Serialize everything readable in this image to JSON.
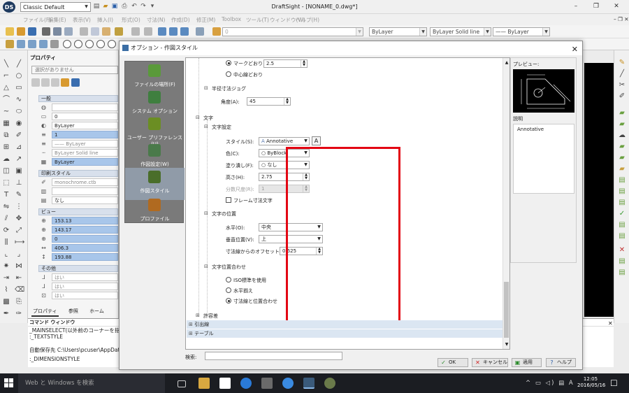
{
  "app": {
    "workspace": "Classic Default",
    "title": "DraftSight - [NONAME_0.dwg*]",
    "menus": [
      "ファイル(F)",
      "編集(E)",
      "表示(V)",
      "挿入(I)",
      "形式(O)",
      "寸法(N)",
      "作成(D)",
      "修正(M)",
      "Toolbox",
      "ツール(T)",
      "ウィンドウ(W)",
      "ヘルプ(H)"
    ]
  },
  "toolbar": {
    "layer_combo": "0",
    "color_combo": "ByLayer",
    "linestyle_combo": "ByLayer    Solid line",
    "lineweight_combo": "—— ByLayer"
  },
  "properties": {
    "title": "プロパティ",
    "selection": "選択がありません",
    "sections": {
      "general": "一般",
      "print_style": "印刷スタイル",
      "view": "ビュー",
      "other": "その他"
    },
    "general_rows": [
      "",
      "0",
      "ByLayer",
      "1",
      "—— ByLayer",
      "ByLayer    Solid line",
      "ByLayer"
    ],
    "print_rows": [
      "monochrome.ctb",
      "",
      "なし"
    ],
    "view_rows": [
      "153.13",
      "143.17",
      "0",
      "406.3",
      "193.88"
    ],
    "other_rows": [
      "はい",
      "はい",
      "はい"
    ],
    "tabs": [
      "プロパティ",
      "参照",
      "ホーム"
    ]
  },
  "command_window": {
    "title": "コマンド ウィンドウ",
    "lines": [
      "_MAINSELECT(以外前のコーナーを指定):",
      ":_TEXTSTYLE",
      "自動保存先 C:\\Users\\pcuser\\AppData",
      ":_DIMENSIONSTYLE"
    ]
  },
  "dialog": {
    "title": "オプション - 作図スタイル",
    "nav": [
      {
        "label": "ファイルの場所(F)",
        "icon": "folder-icon",
        "color": "#5a9a3a"
      },
      {
        "label": "システム オプション",
        "icon": "system-options-icon",
        "color": "#3f7f3f"
      },
      {
        "label": "ユーザー プリファレンス(U)",
        "icon": "user-preferences-icon",
        "color": "#6b8e23"
      },
      {
        "label": "作図設定(W)",
        "icon": "drawing-settings-icon",
        "color": "#4a7a4a"
      },
      {
        "label": "作図スタイル",
        "icon": "drafting-styles-icon",
        "color": "#4a6e2a"
      },
      {
        "label": "プロファイル",
        "icon": "profile-icon",
        "color": "#b06a20"
      }
    ],
    "tree": {
      "marker_radio": "マークどおり",
      "marker_value": "2.5",
      "center_line": "中心線どおり",
      "radius_jog": "半径寸法ジョグ",
      "angle_label": "角度(A):",
      "angle_value": "45",
      "text": "文字",
      "text_settings": "文字設定",
      "style_label": "スタイル(S):",
      "style_value": "Annotative",
      "color_label": "色(C):",
      "color_value": "ByBlock",
      "fill_label": "塗り潰し(F):",
      "fill_value": "なし",
      "height_label": "高さ(H):",
      "height_value": "2.75",
      "fraction_label": "分数尺度(R):",
      "fraction_value": "1",
      "frame_label": "フレーム寸法文字",
      "text_position": "文字の位置",
      "horizontal_label": "水平(O):",
      "horizontal_value": "中央",
      "vertical_label": "垂直位置(V):",
      "vertical_value": "上",
      "offset_label": "寸法線からのオフセット(D):",
      "offset_value": "0.625",
      "text_alignment": "文字位置合わせ",
      "iso_label": "ISO標準を使用",
      "horiz_label": "水平揃え",
      "align_label": "寸法線と位置合わせ",
      "tolerance": "許容差",
      "leader": "引出線",
      "table": "テーブル"
    },
    "search_label": "検索:",
    "preview_label": "プレビュー:",
    "description_label": "説明",
    "description_value": "Annotative",
    "buttons": {
      "ok": "OK",
      "cancel": "キャンセル",
      "apply": "適用",
      "help": "ヘルプ"
    }
  },
  "taskbar": {
    "search_placeholder": "Web と Windows を検索",
    "time": "12:05",
    "date": "2016/05/16",
    "ime": "A"
  },
  "colors": {
    "highlight_red": "#e30613",
    "selection_blue": "#a8c6ea",
    "nav_gray": "#7a7a7a"
  }
}
